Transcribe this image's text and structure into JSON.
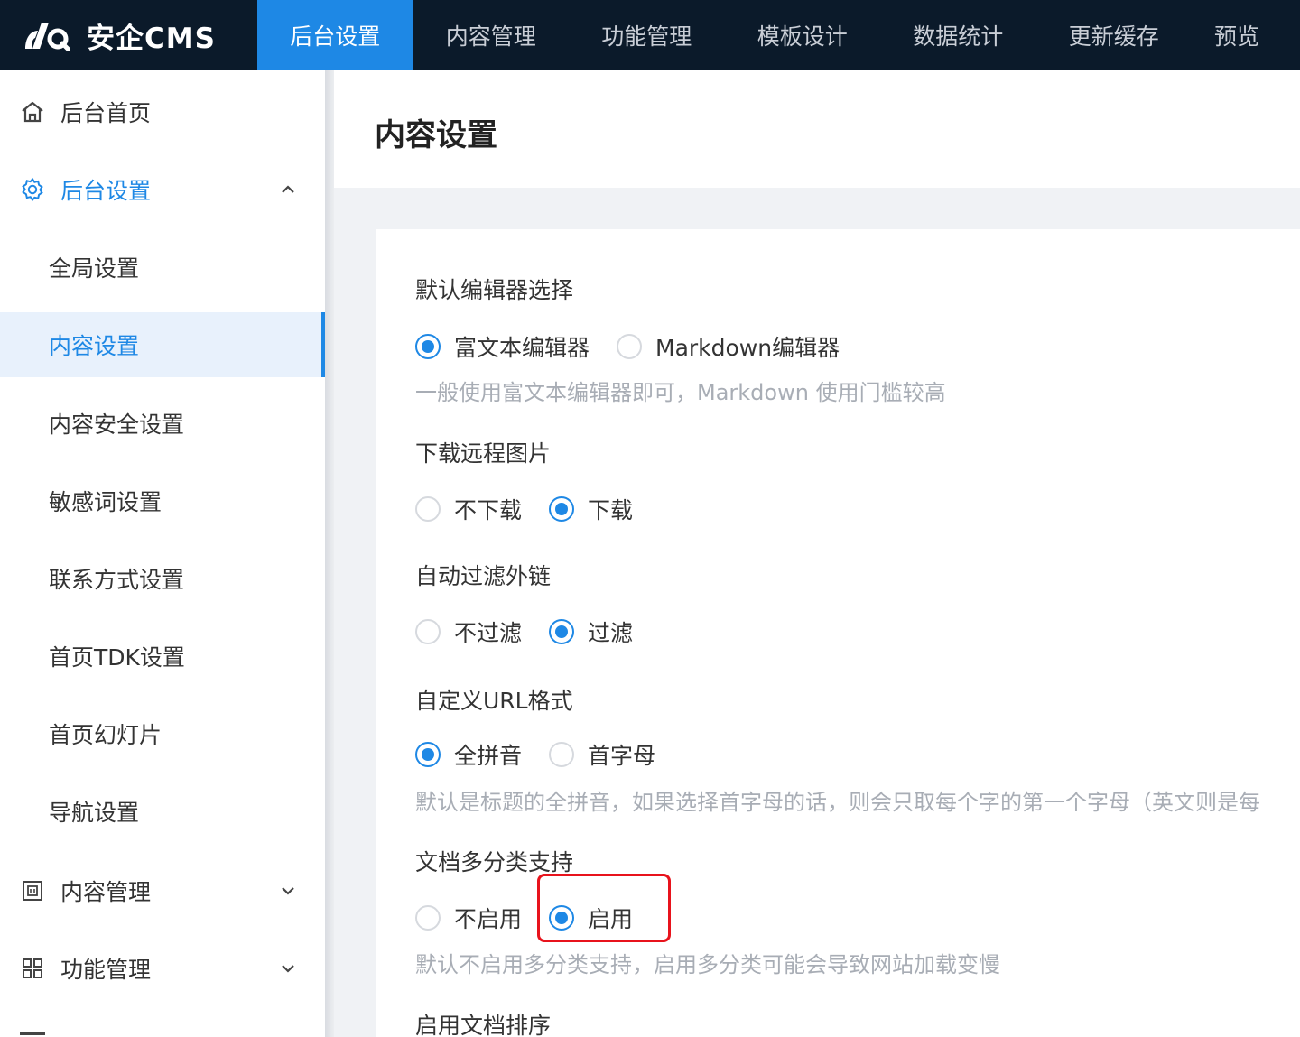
{
  "brand": {
    "name": "安企CMS"
  },
  "topnav": {
    "tabs": [
      {
        "label": "后台设置",
        "active": true
      },
      {
        "label": "内容管理"
      },
      {
        "label": "功能管理"
      },
      {
        "label": "模板设计"
      },
      {
        "label": "数据统计"
      },
      {
        "label": "更新缓存"
      },
      {
        "label": "预览"
      }
    ]
  },
  "sidebar": {
    "items": [
      {
        "label": "后台首页",
        "icon": "home-icon"
      },
      {
        "label": "后台设置",
        "icon": "gear-icon",
        "expanded": true
      },
      {
        "label": "全局设置"
      },
      {
        "label": "内容设置",
        "selected": true
      },
      {
        "label": "内容安全设置"
      },
      {
        "label": "敏感词设置"
      },
      {
        "label": "联系方式设置"
      },
      {
        "label": "首页TDK设置"
      },
      {
        "label": "首页幻灯片"
      },
      {
        "label": "导航设置"
      },
      {
        "label": "内容管理",
        "icon": "document-icon"
      },
      {
        "label": "功能管理",
        "icon": "apps-grid-icon"
      }
    ]
  },
  "page": {
    "title": "内容设置"
  },
  "form": {
    "editor": {
      "label": "默认编辑器选择",
      "options": [
        "富文本编辑器",
        "Markdown编辑器"
      ],
      "selected": "富文本编辑器",
      "hint": "一般使用富文本编辑器即可，Markdown 使用门槛较高"
    },
    "remote_images": {
      "label": "下载远程图片",
      "options": [
        "不下载",
        "下载"
      ],
      "selected": "下载"
    },
    "filter_links": {
      "label": "自动过滤外链",
      "options": [
        "不过滤",
        "过滤"
      ],
      "selected": "过滤"
    },
    "url_format": {
      "label": "自定义URL格式",
      "options": [
        "全拼音",
        "首字母"
      ],
      "selected": "全拼音",
      "hint": "默认是标题的全拼音，如果选择首字母的话，则会只取每个字的第一个字母（英文则是每"
    },
    "multi_category": {
      "label": "文档多分类支持",
      "options": [
        "不启用",
        "启用"
      ],
      "selected": "启用",
      "hint": "默认不启用多分类支持，启用多分类可能会导致网站加载变慢"
    },
    "doc_sort": {
      "label": "启用文档排序"
    }
  },
  "colors": {
    "accent": "#1e88e5",
    "topbar": "#0b1a2a",
    "highlight": "#e8131c"
  }
}
